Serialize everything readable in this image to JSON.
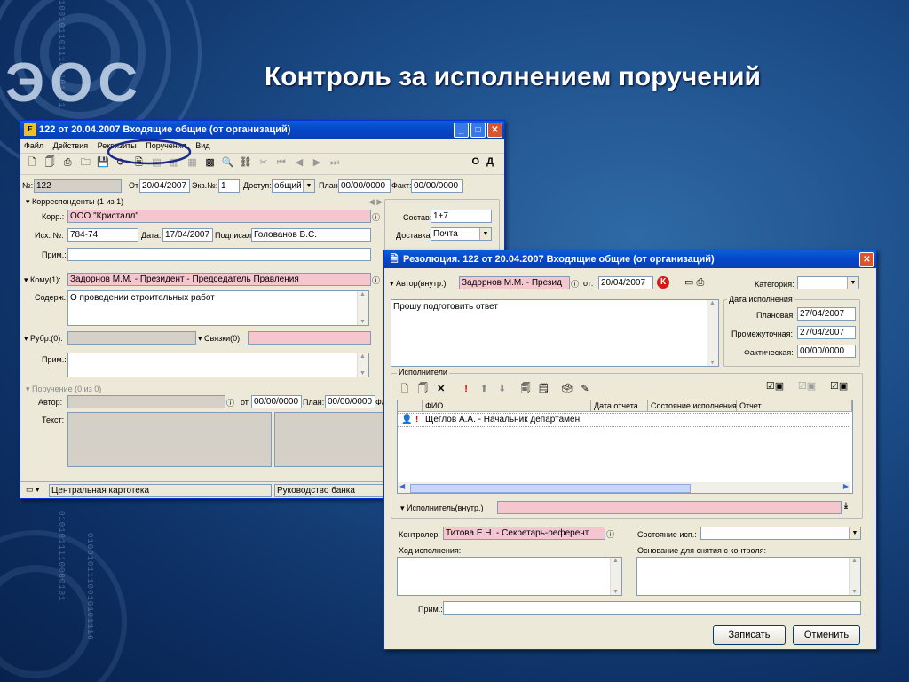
{
  "slide": {
    "title": "Контроль за исполнением поручений",
    "logo": "ЭОС",
    "binary_left": "0100101110010101110",
    "binary_top": "1001011011100101001",
    "binary_bottom": "0101011110000101"
  },
  "win1": {
    "title": "122 от 20.04.2007 Входящие общие (от организаций)",
    "menu": [
      "Файл",
      "Действия",
      "Реквизиты",
      "Поручения",
      "Вид"
    ],
    "toolbar_right": [
      "О",
      "Д"
    ],
    "num_label": "№:",
    "num": "122",
    "from_label": "От:",
    "from": "20/04/2007",
    "copy_label": "Экз.№:",
    "copy": "1",
    "access_label": "Доступ:",
    "access": "общий",
    "plan_label": "План:",
    "plan": "00/00/0000",
    "fact_label": "Факт:",
    "fact": "00/00/0000",
    "corr_section": "Корреспонденты (1 из 1)",
    "corr_label": "Корр.:",
    "corr": "ООО \"Кристалл\"",
    "isx_label": "Исх. №:",
    "isx": "784-74",
    "date_label": "Дата:",
    "date": "17/04/2007",
    "signed_label": "Подписал:",
    "signed": "Голованов В.С.",
    "prim_label": "Прим.:",
    "sostav_label": "Состав:",
    "sostav": "1+7",
    "dostavka_label": "Доставка:",
    "dostavka": "Почта",
    "komu_label": "Кому(1):",
    "komu": "Задорнов М.М. - Президент - Председатель Правления",
    "soderzh_label": "Содерж.:",
    "soderzh": "О проведении строительных работ",
    "rubr_label": "Рубр.(0):",
    "svyazi_label": "Связки(0):",
    "prim2_label": "Прим.:",
    "poruch_section": "Поручение (0 из 0)",
    "avtor_label": "Автор:",
    "ot_label": "от",
    "ot": "00/00/0000",
    "plan2_label": "План:",
    "plan2": "00/00/0000",
    "fa_label": "Фа",
    "tekst_label": "Текст:",
    "status_left": "Центральная картотека",
    "status_right": "Руководство банка"
  },
  "win2": {
    "title": "Резолюция. 122 от 20.04.2007 Входящие общие (от организаций)",
    "author_label": "Автор(внутр.)",
    "author": "Задорнов М.М. - Презид",
    "ot_label": "от:",
    "ot": "20/04/2007",
    "k_badge": "К",
    "category_label": "Категория:",
    "category": "",
    "text": "Прошу подготовить ответ",
    "date_group": "Дата исполнения",
    "planned_label": "Плановая:",
    "planned": "27/04/2007",
    "interim_label": "Промежуточная:",
    "interim": "27/04/2007",
    "actual_label": "Фактическая:",
    "actual": "00/00/0000",
    "executors_label": "Исполнители",
    "columns": [
      "ФИО",
      "Дата отчета",
      "Состояние исполнения",
      "Отчет"
    ],
    "rows": [
      {
        "mark": "!",
        "name": "Щеглов А.А. - Начальник департамен",
        "date": "",
        "state": "",
        "report": ""
      }
    ],
    "executor_inner_label": "Исполнитель(внутр.)",
    "controller_label": "Контролер:",
    "controller": "Титова Е.Н. - Секретарь-референт",
    "state_label": "Состояние исп.:",
    "state": "",
    "progress_label": "Ход исполнения:",
    "basis_label": "Основание для снятия с контроля:",
    "prim_label": "Прим.:",
    "save": "Записать",
    "cancel": "Отменить"
  }
}
